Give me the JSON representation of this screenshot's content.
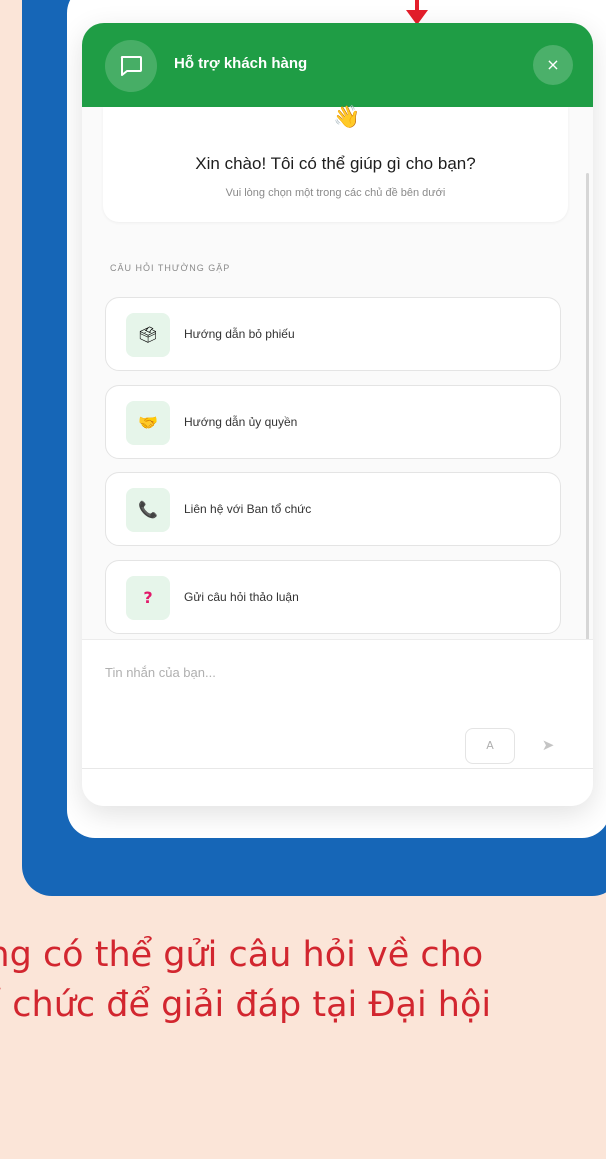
{
  "widget": {
    "header_title": "Hỗ trợ khách hàng",
    "close_label": "×",
    "welcome_emoji": "👋",
    "welcome_title": "Xin chào! Tôi có thể giúp gì cho bạn?",
    "welcome_subtitle": "Vui lòng chọn một trong các chủ đề bên dưới",
    "faq_label": "CÂU HỎI THƯỜNG GẶP",
    "faq_items": [
      {
        "label": "Hướng dẫn bỏ phiếu",
        "icon": "ballot-box-icon",
        "glyph": "🗳"
      },
      {
        "label": "Hướng dẫn ủy quyền",
        "icon": "handshake-icon",
        "glyph": "🤝"
      },
      {
        "label": "Liên hệ với Ban tổ chức",
        "icon": "phone-icon",
        "glyph": "📞"
      },
      {
        "label": "Gửi câu hỏi thảo luận",
        "icon": "question-icon",
        "glyph": "?"
      }
    ],
    "input_placeholder": "Tin nhắn của bạn...",
    "format_label": "A",
    "send_label": "➤"
  },
  "caption": {
    "line1": "ông có thể gửi câu hỏi về cho",
    "line2": "tổ chức để giải đáp tại Đại hội"
  },
  "colors": {
    "brand_green": "#1f9d45",
    "frame_blue": "#1666b7",
    "caption_red": "#d2262f",
    "background_peach": "#fbe5d8"
  }
}
